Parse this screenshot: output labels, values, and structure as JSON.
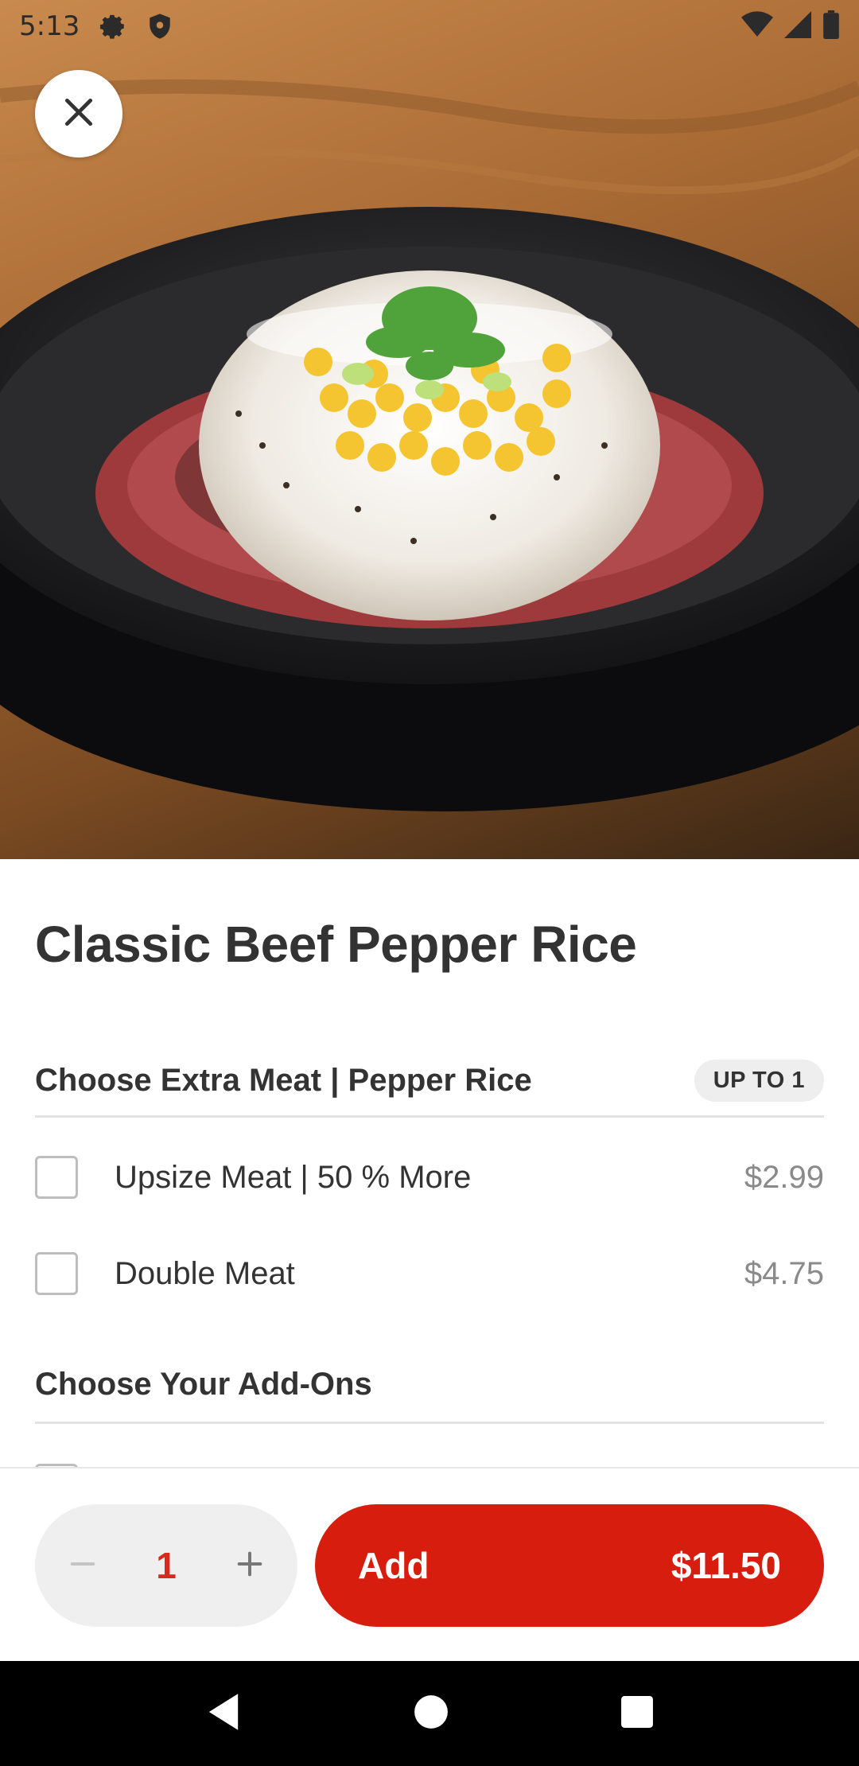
{
  "status_bar": {
    "time": "5:13",
    "icons": [
      "gear-icon",
      "shield-icon",
      "wifi-icon",
      "signal-icon",
      "battery-icon"
    ]
  },
  "hero": {
    "image_description_icon": "food-photo"
  },
  "item": {
    "title": "Classic Beef Pepper Rice"
  },
  "sections": [
    {
      "label": "Choose Extra Meat | Pepper Rice",
      "badge": "UP TO 1",
      "options": [
        {
          "label": "Upsize Meat | 50 % More",
          "price": "$2.99",
          "checked": false
        },
        {
          "label": "Double Meat",
          "price": "$4.75",
          "checked": false
        }
      ]
    },
    {
      "label": "Choose Your Add-Ons"
    }
  ],
  "cart": {
    "quantity": "1",
    "add_label": "Add",
    "price": "$11.50"
  },
  "colors": {
    "accent": "#d71e0e",
    "quantity_text": "#d52b1e",
    "text": "#333333",
    "price_text": "#8a8a8a"
  }
}
